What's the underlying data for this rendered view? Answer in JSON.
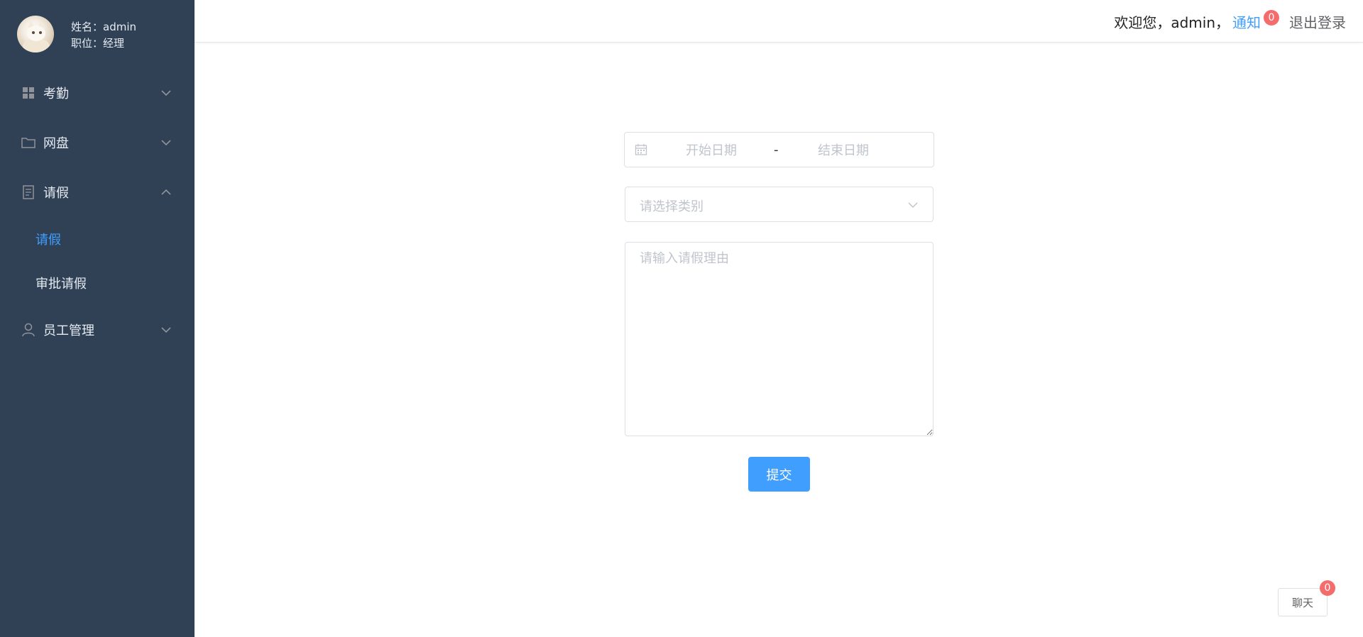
{
  "theme": {
    "sidebar_bg": "#304156",
    "accent": "#409eff",
    "badge": "#f56c6c"
  },
  "profile": {
    "name_line": "姓名：admin",
    "role_line": "职位：经理",
    "avatar_icon": "cat-avatar"
  },
  "sidebar": {
    "items": [
      {
        "label": "考勤",
        "icon": "grid-icon",
        "expanded": false
      },
      {
        "label": "网盘",
        "icon": "folder-icon",
        "expanded": false
      },
      {
        "label": "请假",
        "icon": "document-icon",
        "expanded": true,
        "children": [
          {
            "label": "请假",
            "active": true
          },
          {
            "label": "审批请假",
            "active": false
          }
        ]
      },
      {
        "label": "员工管理",
        "icon": "user-icon",
        "expanded": false
      }
    ]
  },
  "header": {
    "welcome": "欢迎您，admin，",
    "notify_label": "通知",
    "notify_count": "0",
    "logout_label": "退出登录"
  },
  "form": {
    "start_placeholder": "开始日期",
    "range_separator": "-",
    "end_placeholder": "结束日期",
    "category_placeholder": "请选择类别",
    "reason_placeholder": "请输入请假理由",
    "submit_label": "提交"
  },
  "chat": {
    "label": "聊天",
    "count": "0"
  }
}
